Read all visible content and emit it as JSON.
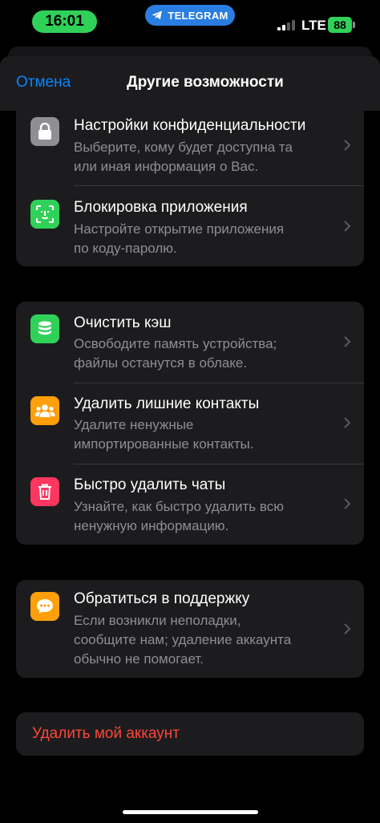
{
  "status_bar": {
    "time": "16:01",
    "app_indicator": "TELEGRAM",
    "network": "LTE",
    "battery": "88",
    "colors": {
      "time_pill": "#30d158",
      "app_pill": "#2a7de1",
      "battery": "#30d158"
    }
  },
  "nav": {
    "cancel_label": "Отмена",
    "title": "Другие возможности",
    "accent": "#0a84ff"
  },
  "groups": [
    {
      "rows": [
        {
          "icon": "lock-icon",
          "icon_color": "#8e8e93",
          "title": "Настройки конфиденциальности",
          "subtitle": "Выберите, кому будет доступна та\nили иная информация о Вас."
        },
        {
          "icon": "face-id-icon",
          "icon_color": "#30d158",
          "title": "Блокировка приложения",
          "subtitle": "Настройте открытие приложения\nпо коду-паролю."
        }
      ]
    },
    {
      "rows": [
        {
          "icon": "database-icon",
          "icon_color": "#30d158",
          "title": "Очистить кэш",
          "subtitle": "Освободите память устройства;\nфайлы останутся в облаке."
        },
        {
          "icon": "people-icon",
          "icon_color": "#ff9f0a",
          "title": "Удалить лишние контакты",
          "subtitle": "Удалите ненужные\nимпортированные контакты."
        },
        {
          "icon": "trash-icon",
          "icon_color": "#ff375f",
          "title": "Быстро удалить чаты",
          "subtitle": "Узнайте, как быстро удалить всю\nненужную информацию."
        }
      ]
    },
    {
      "rows": [
        {
          "icon": "chat-bubble-icon",
          "icon_color": "#ff9f0a",
          "title": "Обратиться в поддержку",
          "subtitle": "Если возникли неполадки,\nсообщите нам; удаление аккаунта\nобычно не помогает."
        }
      ]
    }
  ],
  "danger_action": {
    "label": "Удалить мой аккаунт",
    "color": "#ff453a"
  }
}
